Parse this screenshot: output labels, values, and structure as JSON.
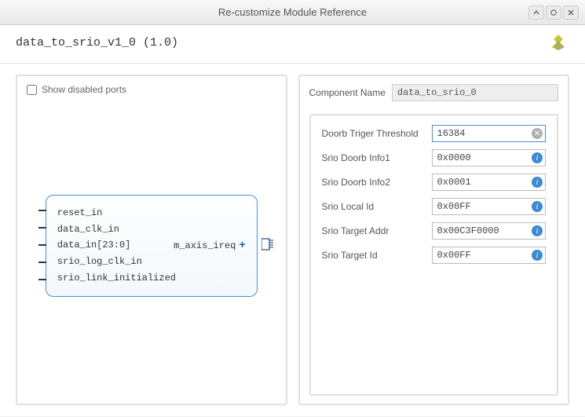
{
  "window": {
    "title": "Re-customize Module Reference"
  },
  "header": {
    "module_title": "data_to_srio_v1_0 (1.0)"
  },
  "left": {
    "checkbox_label": "Show disabled ports",
    "block": {
      "inputs": [
        "reset_in",
        "data_clk_in",
        "data_in[23:0]",
        "srio_log_clk_in",
        "srio_link_initialized"
      ],
      "output": "m_axis_ireq"
    }
  },
  "right": {
    "component_name_label": "Component Name",
    "component_name_value": "data_to_srio_0",
    "params": [
      {
        "label": "Doorb Triger Threshold",
        "value": "16384",
        "icon": "clear"
      },
      {
        "label": "Srio Doorb Info1",
        "value": "0x0000",
        "icon": "info"
      },
      {
        "label": "Srio Doorb Info2",
        "value": "0x0001",
        "icon": "info"
      },
      {
        "label": "Srio Local Id",
        "value": "0x00FF",
        "icon": "info"
      },
      {
        "label": "Srio Target Addr",
        "value": "0x00C3F0000",
        "icon": "info"
      },
      {
        "label": "Srio Target Id",
        "value": "0x00FF",
        "icon": "info"
      }
    ]
  }
}
